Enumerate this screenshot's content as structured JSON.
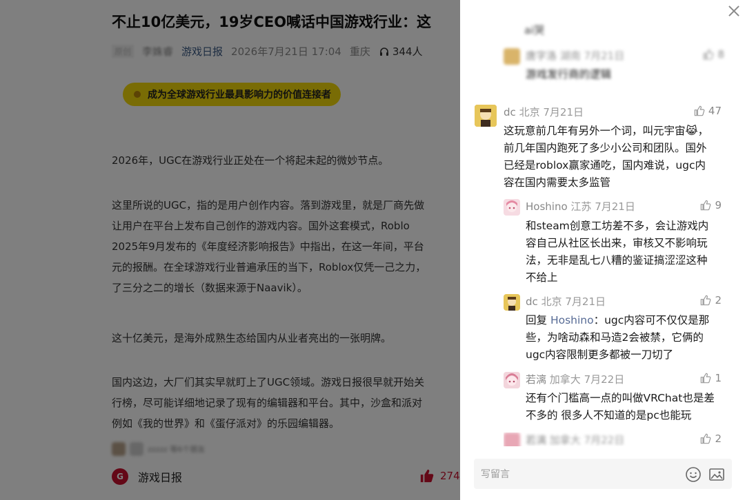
{
  "article": {
    "title": "不止10亿美元，19岁CEO喊话中国游戏行业：这",
    "meta": {
      "tag": "原创",
      "author": "李姝睿",
      "source": "游戏日报",
      "datetime": "2026年7月21日 17:04",
      "location": "重庆",
      "audience": "344人"
    },
    "banner": "成为全球游戏行业最具影响力的价值连接者",
    "paragraphs": [
      [
        "2026年，UGC在游戏行业正处在一个将起未起的微妙节点。"
      ],
      [
        "这里所说的UGC，指的是用户创作内容。落到游戏里，就是厂商先做",
        "让用户在平台上发布自己创作的游戏内容。国外这套模式，Roblo",
        "2025年9月发布的《年度经济影响报告》中指出，在这一年间，平台",
        "元的报酬。在全球游戏行业普遍承压的当下，Roblox仅凭一己之力，",
        "了三分之二的增长（数据来源于Naavik）。"
      ],
      [
        "这十亿美元，是海外成熟生态给国内从业者亮出的一张明牌。"
      ],
      [
        "国内这边，大厂们其实早就盯上了UGC领域。游戏日报很早就开始关",
        "行榜，尽可能详细地记录了现有的编辑器和平台。其中，沙盒和派对",
        "例如《我的世界》和《蛋仔派对》的乐园编辑器。"
      ]
    ],
    "reactors_text": "zzzzz 等6个朋友",
    "bottom": {
      "logo": "G",
      "name": "游戏日报",
      "likes": "274"
    }
  },
  "comments_panel": {
    "comments": [
      {
        "name": "",
        "location": "",
        "date": "",
        "likes": "",
        "text": "ai哭",
        "blurred": true,
        "avatar_color": "#ffffff"
      },
      {
        "name": "唐字洛",
        "location": "湖南",
        "date": "7月21日",
        "likes": "8",
        "text": "游戏发行商的逻辑",
        "blurred": true,
        "avatar_color": "#d9b46a"
      },
      {
        "name": "dc",
        "location": "北京",
        "date": "7月21日",
        "likes": "47",
        "lines": [
          "这玩意前几年有另外一个词，叫元宇宙😹，",
          "前几年国内跑死了多少小公司和团队。国外",
          "已经是roblox赢家通吃，国内难说，ugc内",
          "容在国内需要太多监管"
        ],
        "avatar_color": "#c49a2c"
      },
      {
        "name": "Hoshino",
        "location": "江苏",
        "date": "7月21日",
        "likes": "9",
        "lines": [
          "和steam创意工坊差不多，会让游戏内",
          "容自己从社区长出来，审核又不影响玩",
          "法，无非是乱七八糟的鉴证搞涩涩这种",
          "不给上"
        ],
        "avatar_color": "#e8a7b5"
      },
      {
        "name": "dc",
        "location": "北京",
        "date": "7月21日",
        "likes": "2",
        "reply_prefix": "回复 ",
        "reply_to": "Hoshino",
        "reply_colon": "：",
        "lines": [
          "ugc内容可不仅仅是那",
          "些，为啥动森和马造2会被禁，它俩的",
          "ugc内容限制更多都被一刀切了"
        ],
        "avatar_color": "#c49a2c"
      },
      {
        "name": "若漓",
        "location": "加拿大",
        "date": "7月22日",
        "likes": "1",
        "lines": [
          "还有个门槛高一点的叫做VRChat也是差",
          "不多的 很多人不知道的是pc也能玩"
        ],
        "avatar_color": "#e8a7b5"
      },
      {
        "name": "若漓",
        "location": "加拿大",
        "date": "7月22日",
        "likes": "2",
        "blurred": true,
        "avatar_color": "#e8a7b5"
      }
    ],
    "input_placeholder": "写留言",
    "icons": {
      "close": "close-icon",
      "like": "thumbs-up-icon",
      "emoji": "smiley-icon",
      "image": "image-icon",
      "audience": "headphones-icon"
    }
  }
}
